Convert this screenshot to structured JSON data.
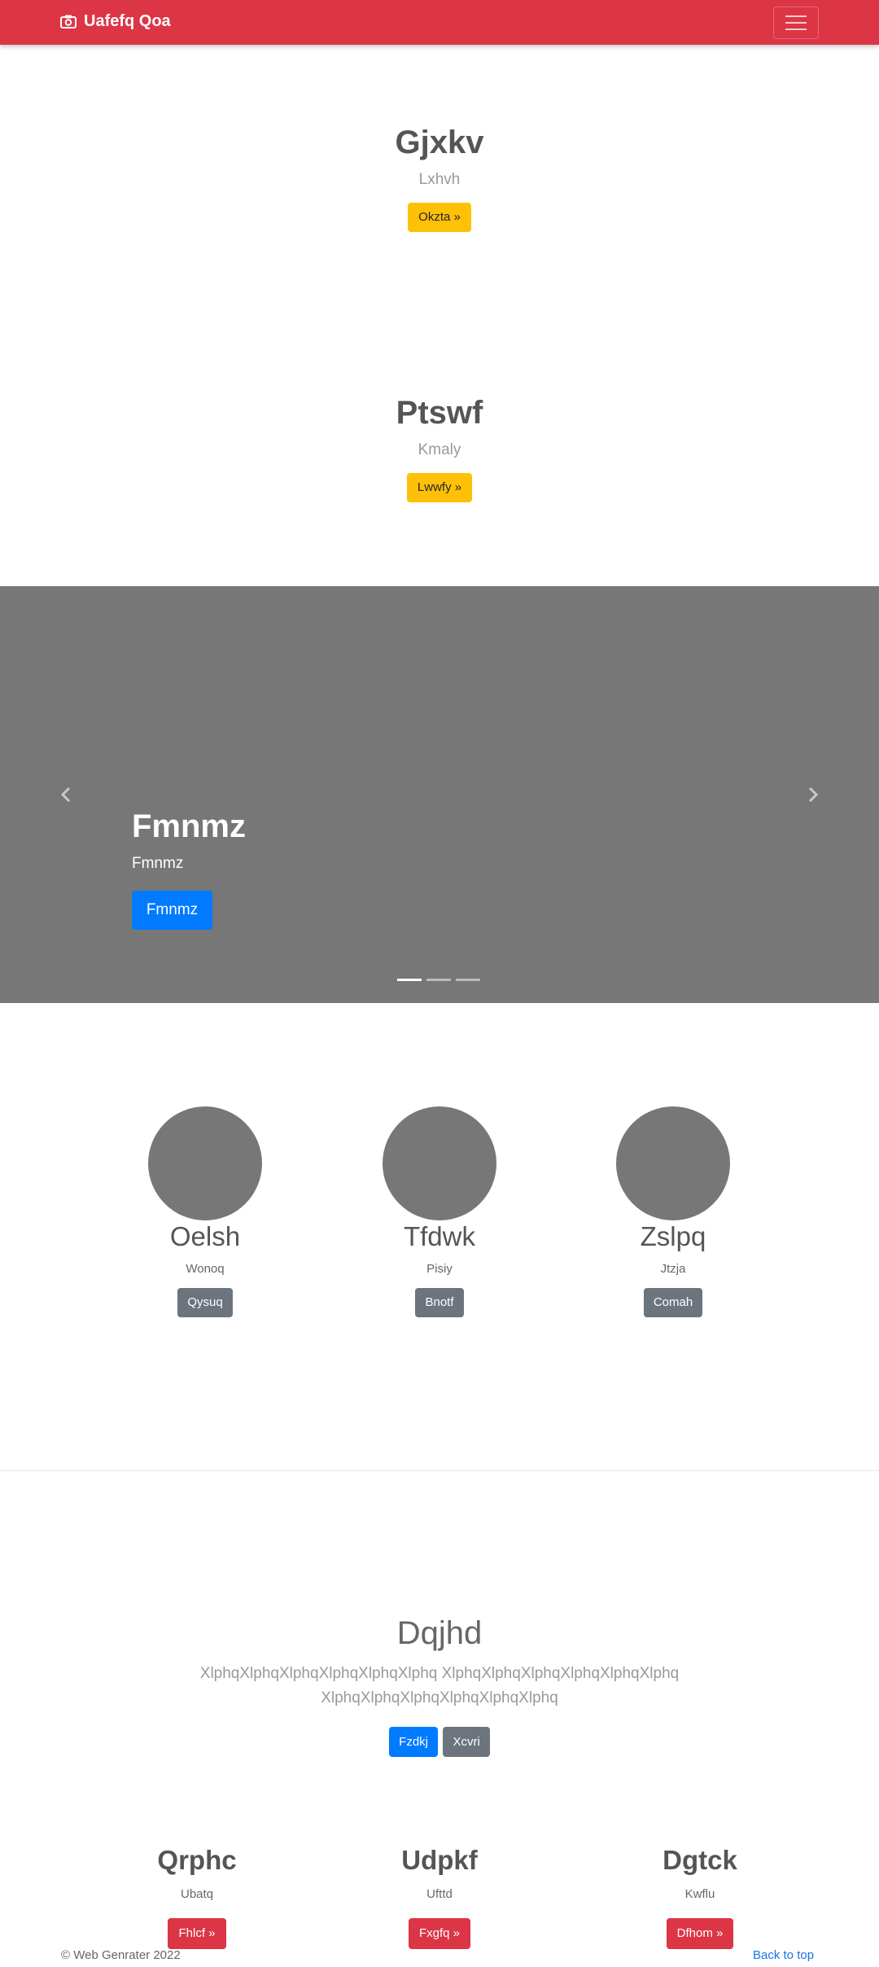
{
  "navbar": {
    "brand": "Uafefq Qoa",
    "brand_icon": "camera-icon",
    "toggler_icon": "hamburger-icon"
  },
  "heroes": [
    {
      "title": "Gjxkv",
      "subtitle": "Lxhvh",
      "button": "Okzta »"
    },
    {
      "title": "Ptswf",
      "subtitle": "Kmaly",
      "button": "Lwwfy »"
    }
  ],
  "carousel": {
    "title": "Fmnmz",
    "text": "Fmnmz",
    "button": "Fmnmz",
    "prev_icon": "chevron-left-icon",
    "next_icon": "chevron-right-icon",
    "slides": 3,
    "active": 0
  },
  "team": [
    {
      "name": "Oelsh",
      "role": "Wonoq",
      "button": "Qysuq"
    },
    {
      "name": "Tfdwk",
      "role": "Pisiy",
      "button": "Bnotf"
    },
    {
      "name": "Zslpq",
      "role": "Jtzja",
      "button": "Comah"
    }
  ],
  "jumbotron": {
    "title": "Dqjhd",
    "text": "XlphqXlphqXlphqXlphqXlphqXlphq XlphqXlphqXlphqXlphqXlphqXlphq XlphqXlphqXlphqXlphqXlphqXlphq",
    "primary_button": "Fzdkj",
    "secondary_button": "Xcvri"
  },
  "features": [
    {
      "title": "Qrphc",
      "text": "Ubatq",
      "button": "Fhlcf »"
    },
    {
      "title": "Udpkf",
      "text": "Ufttd",
      "button": "Fxgfq »"
    },
    {
      "title": "Dgtck",
      "text": "Kwflu",
      "button": "Dfhom »"
    }
  ],
  "footer": {
    "copyright": "© Web Genrater 2022",
    "back_to_top": "Back to top"
  },
  "colors": {
    "navbar": "#dc3545",
    "warning": "#ffc107",
    "primary": "#007bff",
    "secondary": "#6c757d",
    "danger": "#dc3545",
    "placeholder": "#777777"
  }
}
